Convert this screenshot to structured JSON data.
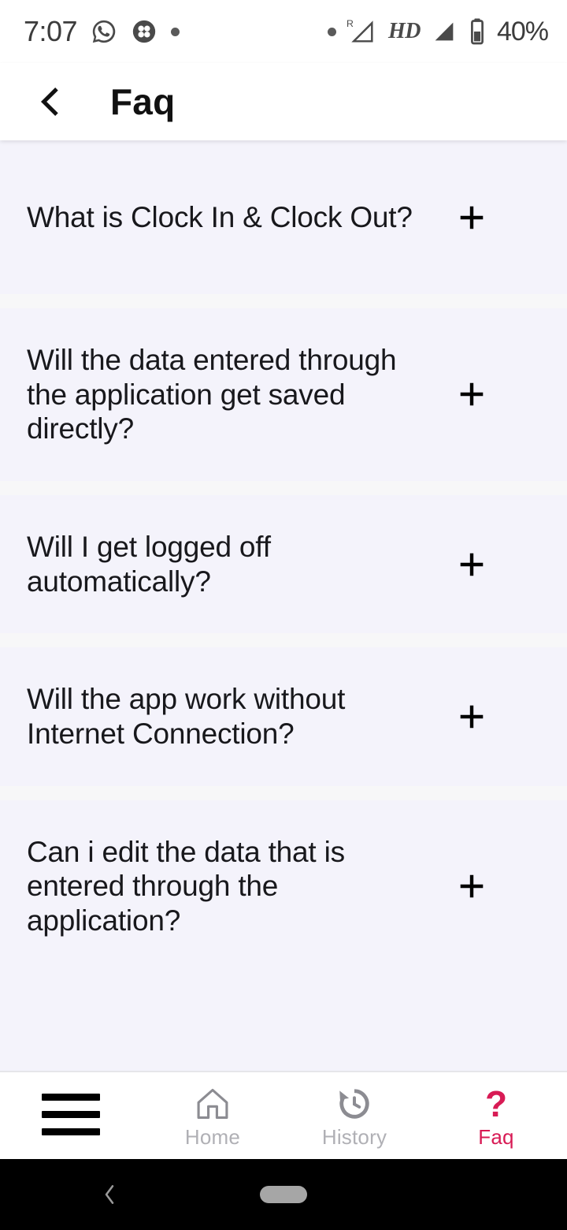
{
  "status_bar": {
    "time": "7:07",
    "battery_percent": "40%",
    "network_label": "HD",
    "roaming_label": "R",
    "icons": [
      "whatsapp-icon",
      "clover-icon",
      "dot-icon",
      "dot-icon",
      "roaming-signal-icon",
      "hd-label",
      "signal-icon",
      "battery-icon"
    ]
  },
  "header": {
    "title": "Faq",
    "back_label": "Back"
  },
  "faq": {
    "items": [
      {
        "question": "What is Clock In & Clock Out?",
        "expander": "+",
        "expanded": false
      },
      {
        "question": "Will the data entered through the application get saved directly?",
        "expander": "+",
        "expanded": false
      },
      {
        "question": "Will I get logged off automatically?",
        "expander": "+",
        "expanded": false
      },
      {
        "question": "Will the app work without Internet Connection?",
        "expander": "+",
        "expanded": false
      },
      {
        "question": "Can i edit the data that is entered through the application?",
        "expander": "+",
        "expanded": false
      }
    ]
  },
  "bottom_nav": {
    "items": [
      {
        "label": "",
        "icon": "hamburger-menu-icon",
        "active": false
      },
      {
        "label": "Home",
        "icon": "home-icon",
        "active": false
      },
      {
        "label": "History",
        "icon": "history-icon",
        "active": false
      },
      {
        "label": "Faq",
        "icon": "question-mark-icon",
        "active": true
      }
    ],
    "active_color": "#d81b55",
    "inactive_color": "#b0b0b5"
  },
  "system_nav": {
    "back": "system-back-icon",
    "home_pill": "home-indicator-pill"
  },
  "colors": {
    "page_background": "#f4f3fb",
    "header_background": "#ffffff",
    "divider": "#f7f7f8",
    "accent": "#d81b55",
    "text_primary": "#18181c"
  }
}
